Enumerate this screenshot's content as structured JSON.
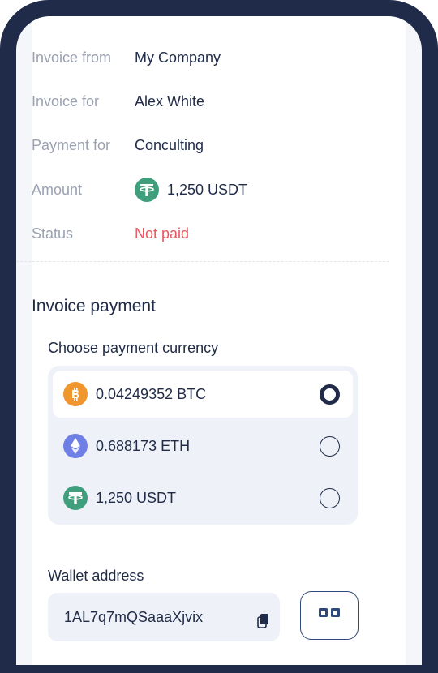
{
  "invoice": {
    "from_label": "Invoice from",
    "from_value": "My Company",
    "for_label": "Invoice for",
    "for_value": "Alex White",
    "payment_for_label": "Payment for",
    "payment_for_value": "Conculting",
    "amount_label": "Amount",
    "amount_value": "1,250 USDT",
    "status_label": "Status",
    "status_value": "Not paid"
  },
  "payment": {
    "section_title": "Invoice payment",
    "choose_label": "Choose payment currency",
    "options": [
      {
        "icon": "btc-icon",
        "amount": "0.04249352 BTC",
        "selected": true
      },
      {
        "icon": "eth-icon",
        "amount": "0.688173 ETH",
        "selected": false
      },
      {
        "icon": "usdt-icon",
        "amount": "1,250 USDT",
        "selected": false
      }
    ]
  },
  "wallet": {
    "label": "Wallet address",
    "address": "1AL7q7mQSaaaXjvix"
  },
  "colors": {
    "navy": "#1f2b48",
    "muted": "#9aa1b1",
    "status_unpaid": "#e5585f",
    "usdt": "#3f9f7c",
    "btc": "#ef962f",
    "eth": "#6e80e6"
  }
}
